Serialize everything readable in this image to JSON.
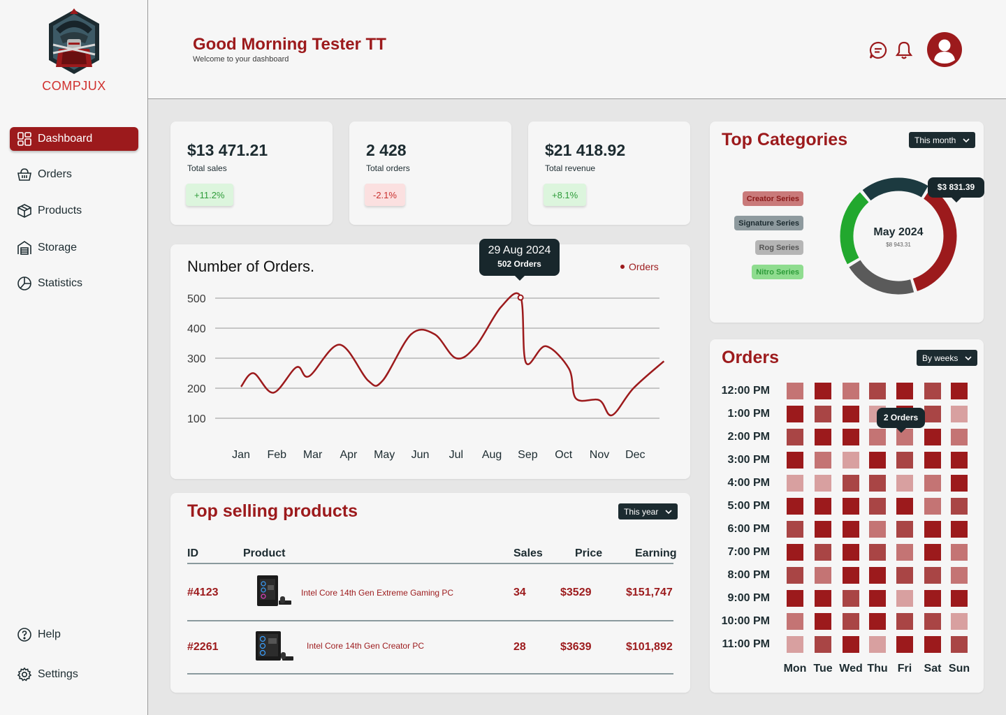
{
  "brand": {
    "name": "COMPJUX"
  },
  "nav": [
    {
      "label": "Dashboard",
      "icon": "dashboard-icon",
      "active": true
    },
    {
      "label": "Orders",
      "icon": "basket-icon"
    },
    {
      "label": "Products",
      "icon": "box-icon"
    },
    {
      "label": "Storage",
      "icon": "warehouse-icon"
    },
    {
      "label": "Statistics",
      "icon": "pie-chart-icon"
    }
  ],
  "nav_bottom": [
    {
      "label": "Help",
      "icon": "help-icon"
    },
    {
      "label": "Settings",
      "icon": "gear-icon"
    }
  ],
  "header": {
    "greeting": "Good Morning Tester TT",
    "subtitle": "Welcome to your dashboard"
  },
  "stats": [
    {
      "value": "$13 471.21",
      "label": "Total sales",
      "change": "+11.2%",
      "trend": "up"
    },
    {
      "value": "2 428",
      "label": "Total orders",
      "change": "-2.1%",
      "trend": "down"
    },
    {
      "value": "$21 418.92",
      "label": "Total revenue",
      "change": "+8.1%",
      "trend": "up"
    }
  ],
  "orders_chart": {
    "title": "Number of Orders.",
    "legend": "Orders",
    "tooltip_date": "29 Aug 2024",
    "tooltip_value": "502 Orders"
  },
  "chart_data": {
    "type": "line",
    "title": "Number of Orders.",
    "categories": [
      "Jan",
      "Feb",
      "Mar",
      "Apr",
      "May",
      "Jun",
      "Jul",
      "Aug",
      "Sep",
      "Oct",
      "Nov",
      "Dec"
    ],
    "yticks": [
      100,
      200,
      300,
      400,
      500
    ],
    "ylim": [
      100,
      500
    ],
    "series": [
      {
        "name": "Orders",
        "color": "#9c1a1c",
        "points": [
          [
            0.0,
            205
          ],
          [
            0.35,
            250
          ],
          [
            0.9,
            185
          ],
          [
            1.55,
            270
          ],
          [
            1.9,
            240
          ],
          [
            2.75,
            345
          ],
          [
            3.55,
            225
          ],
          [
            3.95,
            225
          ],
          [
            4.75,
            380
          ],
          [
            5.4,
            380
          ],
          [
            6.0,
            300
          ],
          [
            6.55,
            340
          ],
          [
            7.25,
            470
          ],
          [
            7.8,
            505
          ],
          [
            7.95,
            285
          ],
          [
            8.5,
            340
          ],
          [
            9.15,
            265
          ],
          [
            9.35,
            165
          ],
          [
            10.0,
            160
          ],
          [
            10.35,
            110
          ],
          [
            10.95,
            200
          ],
          [
            11.8,
            290
          ]
        ]
      }
    ],
    "highlight": {
      "month_position": 7.8,
      "value": 502
    },
    "grid": true,
    "legend_position": "top-right"
  },
  "top_products": {
    "title": "Top selling products",
    "filter": "This year",
    "columns": [
      "ID",
      "Product",
      "Sales",
      "Price",
      "Earning"
    ],
    "rows": [
      {
        "id": "#4123",
        "name": "Intel Core 14th Gen Extreme Gaming PC",
        "sales": "34",
        "price": "$3529",
        "earning": "$151,747"
      },
      {
        "id": "#2261",
        "name": "Intel Core 14th Gen Creator PC",
        "sales": "28",
        "price": "$3639",
        "earning": "$101,892"
      }
    ]
  },
  "categories": {
    "title": "Top Categories",
    "filter": "This month",
    "month": "May 2024",
    "total": "$8 943.31",
    "tooltip": "$3 831.39",
    "items": [
      {
        "name": "Creator Series",
        "bg": "#c97a7a",
        "fg": "#8a1a1a",
        "share": 0.29
      },
      {
        "name": "Signature Series",
        "bg": "#8e9a9e",
        "fg": "#1c2b30",
        "share": 0.16
      },
      {
        "name": "Rog Series",
        "bg": "#b5b5b5",
        "fg": "#555555",
        "share": 0.17
      },
      {
        "name": "Nitro Series",
        "bg": "#8fdc8f",
        "fg": "#2e9c3a",
        "share": 0.18
      }
    ],
    "donut_colors": {
      "Creator Series": "#9c1a1c",
      "Signature Series": "#1c3a40",
      "Rog Series": "#5a5a5a",
      "Nitro Series": "#22a82e"
    }
  },
  "orders_heatmap": {
    "title": "Orders",
    "filter": "By weeks",
    "tooltip": "2 Orders",
    "times": [
      "12:00 PM",
      "1:00 PM",
      "2:00 PM",
      "3:00 PM",
      "4:00 PM",
      "5:00 PM",
      "6:00 PM",
      "7:00 PM",
      "8:00 PM",
      "9:00 PM",
      "10:00 PM",
      "11:00 PM"
    ],
    "days": [
      "Mon",
      "Tue",
      "Wed",
      "Thu",
      "Fri",
      "Sat",
      "Sun"
    ],
    "levels": [
      [
        2,
        4,
        2,
        3,
        4,
        3,
        4
      ],
      [
        4,
        3,
        4,
        1,
        4,
        3,
        1
      ],
      [
        3,
        4,
        4,
        2,
        2,
        4,
        2
      ],
      [
        4,
        2,
        1,
        4,
        3,
        4,
        4
      ],
      [
        1,
        1,
        3,
        3,
        1,
        2,
        4
      ],
      [
        4,
        4,
        4,
        3,
        4,
        2,
        3
      ],
      [
        3,
        4,
        4,
        2,
        3,
        4,
        4
      ],
      [
        4,
        3,
        4,
        3,
        2,
        4,
        2
      ],
      [
        3,
        2,
        4,
        4,
        3,
        3,
        2
      ],
      [
        4,
        4,
        3,
        4,
        1,
        4,
        4
      ],
      [
        2,
        4,
        3,
        4,
        3,
        3,
        1
      ],
      [
        1,
        3,
        4,
        1,
        4,
        4,
        3
      ]
    ],
    "level_colors": [
      "#ffffff",
      "#d8a0a0",
      "#c47474",
      "#a94545",
      "#9c1a1c"
    ]
  }
}
